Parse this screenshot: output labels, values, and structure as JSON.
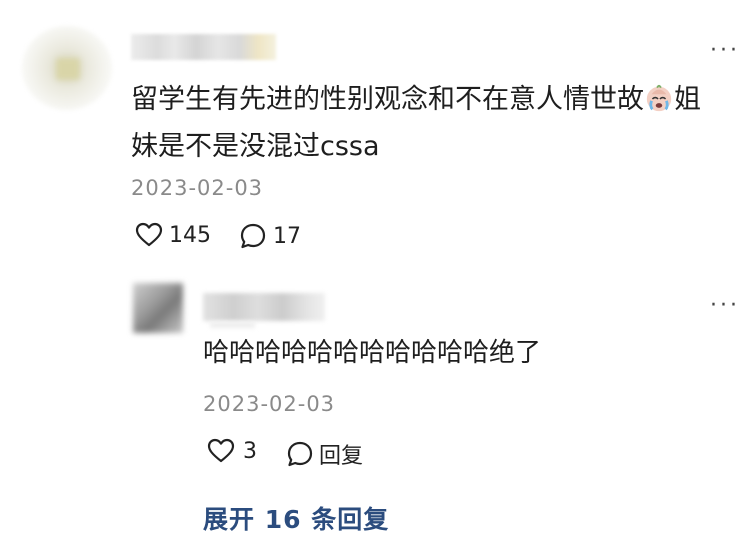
{
  "comment": {
    "text_line1": "留学生有先进的性别观念和不在意人情世故",
    "text_line1_end": "姐",
    "text_line2": "妹是不是没混过cssa",
    "date": "2023-02-03",
    "likes": "145",
    "replies": "17",
    "more_label": "···",
    "emoji_name": "crying-face-icon"
  },
  "reply": {
    "text": "哈哈哈哈哈哈哈哈哈哈哈绝了",
    "date": "2023-02-03",
    "likes": "3",
    "reply_label": "回复",
    "more_label": "···"
  },
  "expand_label": "展开 16 条回复",
  "colors": {
    "link": "#2b4c7e",
    "meta": "#8a8a8a"
  }
}
